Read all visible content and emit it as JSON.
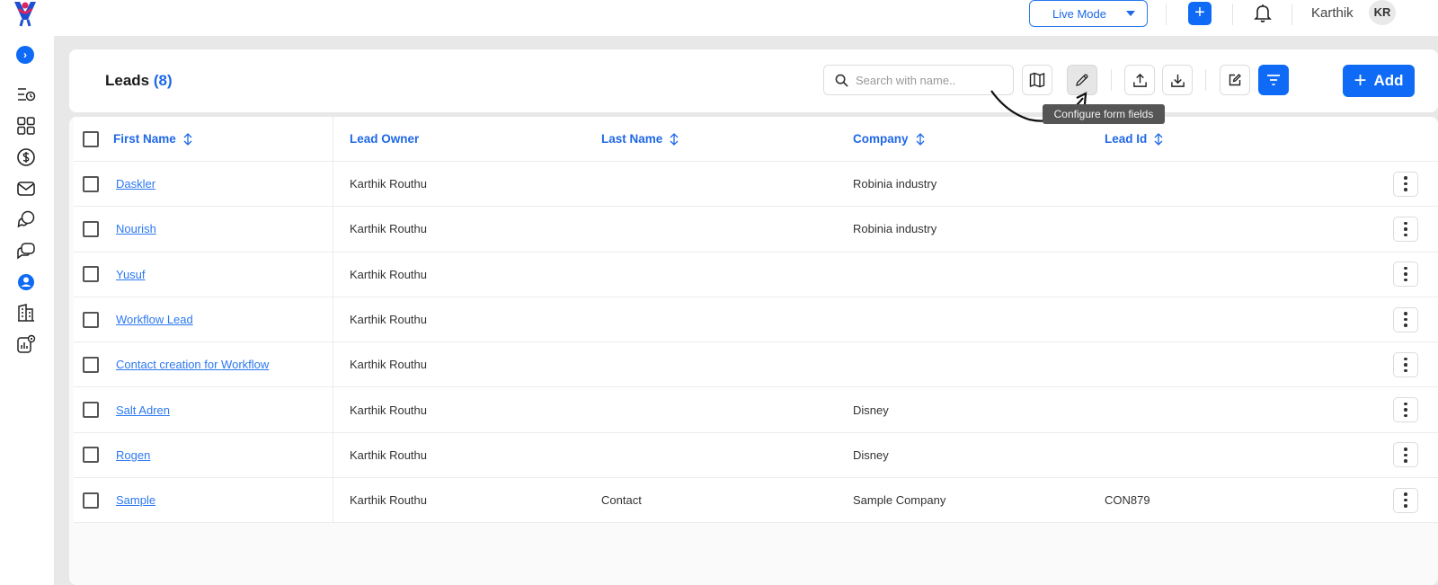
{
  "topbar": {
    "mode_label": "Live Mode",
    "user_name": "Karthik",
    "avatar_initials": "KR",
    "icons": [
      "logo-icon",
      "caret-down-icon",
      "plus-icon",
      "bell-icon"
    ]
  },
  "sidebar": {
    "items": [
      {
        "name": "expand-icon"
      },
      {
        "name": "activity-list-icon"
      },
      {
        "name": "dashboard-grid-icon"
      },
      {
        "name": "dollar-icon"
      },
      {
        "name": "mail-icon"
      },
      {
        "name": "chat-bubbles-icon"
      },
      {
        "name": "conversations-icon"
      },
      {
        "name": "user-circle-icon",
        "active": true
      },
      {
        "name": "building-icon"
      },
      {
        "name": "reports-settings-icon"
      }
    ]
  },
  "header": {
    "title": "Leads",
    "count": "(8)",
    "search_placeholder": "Search with name..",
    "add_label": "Add",
    "tooltip": "Configure form fields"
  },
  "table": {
    "columns": [
      "First Name",
      "Lead Owner",
      "Last Name",
      "Company",
      "Lead Id"
    ],
    "rows": [
      {
        "first": "Daskler",
        "owner": "Karthik Routhu",
        "last": "",
        "company": "Robinia industry",
        "lead_id": ""
      },
      {
        "first": "Nourish",
        "owner": "Karthik Routhu",
        "last": "",
        "company": "Robinia industry",
        "lead_id": ""
      },
      {
        "first": "Yusuf",
        "owner": "Karthik Routhu",
        "last": "",
        "company": "",
        "lead_id": ""
      },
      {
        "first": "Workflow Lead",
        "owner": "Karthik Routhu",
        "last": "",
        "company": "",
        "lead_id": ""
      },
      {
        "first": "Contact creation for Workflow",
        "owner": "Karthik Routhu",
        "last": "",
        "company": "",
        "lead_id": ""
      },
      {
        "first": "Salt Adren",
        "owner": "Karthik Routhu",
        "last": "",
        "company": "Disney",
        "lead_id": ""
      },
      {
        "first": "Rogen",
        "owner": "Karthik Routhu",
        "last": "",
        "company": "Disney",
        "lead_id": ""
      },
      {
        "first": "Sample",
        "owner": "Karthik Routhu",
        "last": "Contact",
        "company": "Sample Company",
        "lead_id": "CON879"
      }
    ]
  },
  "colors": {
    "accent": "#0f6bf5",
    "link": "#2b78f0",
    "canvas": "#e8e8e8"
  }
}
